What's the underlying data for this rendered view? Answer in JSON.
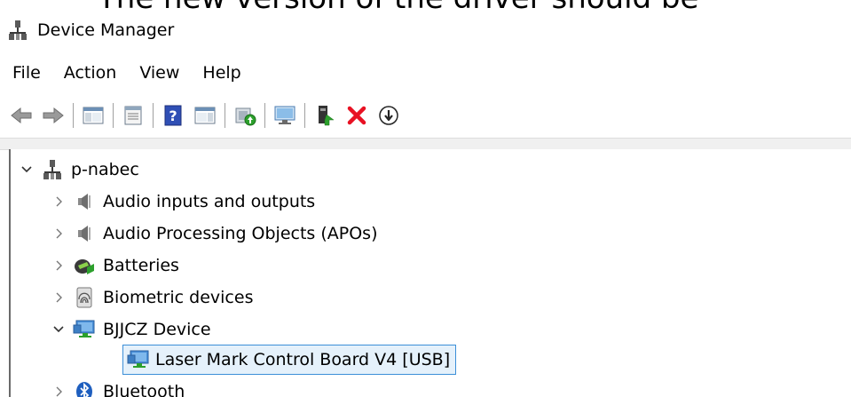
{
  "caption": "The new version of the driver should be",
  "window": {
    "title": "Device Manager"
  },
  "menu": [
    "File",
    "Action",
    "View",
    "Help"
  ],
  "toolbar": [
    {
      "name": "back-icon"
    },
    {
      "name": "forward-icon"
    },
    {
      "sep": true
    },
    {
      "name": "show-hide-console-tree-icon"
    },
    {
      "sep": true
    },
    {
      "name": "properties-icon"
    },
    {
      "sep": true
    },
    {
      "name": "help-icon"
    },
    {
      "name": "show-action-pane-icon"
    },
    {
      "sep": true
    },
    {
      "name": "update-driver-icon"
    },
    {
      "sep": true
    },
    {
      "name": "scan-hardware-icon"
    },
    {
      "sep": true
    },
    {
      "name": "enable-device-icon"
    },
    {
      "name": "uninstall-device-icon"
    },
    {
      "name": "download-driver-icon"
    }
  ],
  "tree": {
    "root": {
      "label": "p-nabec",
      "expanded": true
    },
    "items": [
      {
        "label": "Audio inputs and outputs",
        "icon": "speaker-icon",
        "expanded": false
      },
      {
        "label": "Audio Processing Objects (APOs)",
        "icon": "speaker-icon",
        "expanded": false
      },
      {
        "label": "Batteries",
        "icon": "battery-icon",
        "expanded": false
      },
      {
        "label": "Biometric devices",
        "icon": "fingerprint-icon",
        "expanded": false
      },
      {
        "label": "BJJCZ Device",
        "icon": "monitor-icon",
        "expanded": true,
        "children": [
          {
            "label": "Laser Mark Control Board V4 [USB]",
            "icon": "monitor-icon",
            "selected": true
          }
        ]
      },
      {
        "label": "Bluetooth",
        "icon": "bluetooth-icon",
        "expanded": false
      }
    ]
  },
  "colors": {
    "selection_bg": "#e5f1fb",
    "selection_border": "#3c8fd8",
    "accent_green": "#2ca02c",
    "delete_red": "#e81123"
  }
}
